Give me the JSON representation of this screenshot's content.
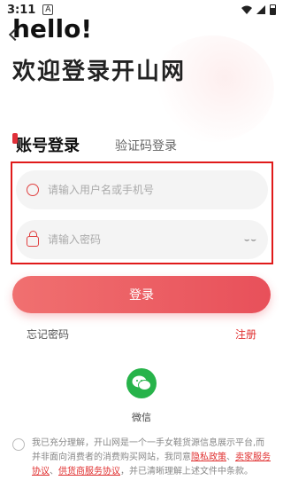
{
  "status": {
    "time": "3:11",
    "app_indicator": "A"
  },
  "header": {
    "greeting": "hello!",
    "title": "欢迎登录开山网"
  },
  "tabs": [
    {
      "label": "账号登录"
    },
    {
      "label": "验证码登录"
    }
  ],
  "form": {
    "username_placeholder": "请输入用户名或手机号",
    "password_placeholder": "请输入密码"
  },
  "actions": {
    "login_label": "登录",
    "forgot_label": "忘记密码",
    "register_label": "注册"
  },
  "social": {
    "wechat_label": "微信"
  },
  "agreement": {
    "text_before": "我已充分理解，开山网是一个一手女鞋货源信息展示平台,而并非面向消费者的消费购买网站，我同意",
    "link_privacy": "隐私政策",
    "sep1": "、",
    "link_seller": "卖家服务协议",
    "sep2": "、",
    "link_supplier": "供货商服务协议",
    "text_after": "，并已清晰理解上述文件中条款。"
  },
  "colors": {
    "accent": "#e8505a",
    "link": "#e03030",
    "wechat": "#27b34a"
  }
}
